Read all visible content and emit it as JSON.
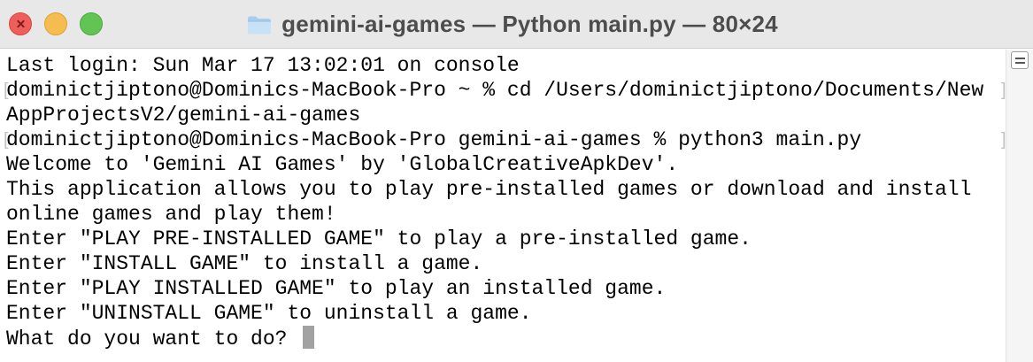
{
  "window": {
    "title": "gemini-ai-games — Python main.py — 80×24",
    "folder_icon": "folder-icon"
  },
  "traffic_lights": {
    "close": "close-icon",
    "minimize": "minimize-icon",
    "zoom": "zoom-icon"
  },
  "terminal": {
    "lines": [
      "Last login: Sun Mar 17 13:02:01 on console",
      "dominictjiptono@Dominics-MacBook-Pro ~ % cd /Users/dominictjiptono/Documents/New",
      "AppProjectsV2/gemini-ai-games",
      "dominictjiptono@Dominics-MacBook-Pro gemini-ai-games % python3 main.py",
      "Welcome to 'Gemini AI Games' by 'GlobalCreativeApkDev'.",
      "This application allows you to play pre-installed games or download and install",
      "online games and play them!",
      "Enter \"PLAY PRE-INSTALLED GAME\" to play a pre-installed game.",
      "Enter \"INSTALL GAME\" to install a game.",
      "Enter \"PLAY INSTALLED GAME\" to play an installed game.",
      "Enter \"UNINSTALL GAME\" to uninstall a game.",
      "What do you want to do? "
    ],
    "cursor": "block-cursor"
  },
  "scrollbar": {
    "button_icon": "scroll-menu-icon"
  },
  "colors": {
    "titlebar": "#e9e8e8",
    "background": "#ffffff",
    "text": "#000000",
    "close": "#ee5f5b",
    "minimize": "#f5bd4f",
    "zoom": "#61c454",
    "cursor": "#a2a2a2",
    "folder": "#b5d6f2"
  }
}
